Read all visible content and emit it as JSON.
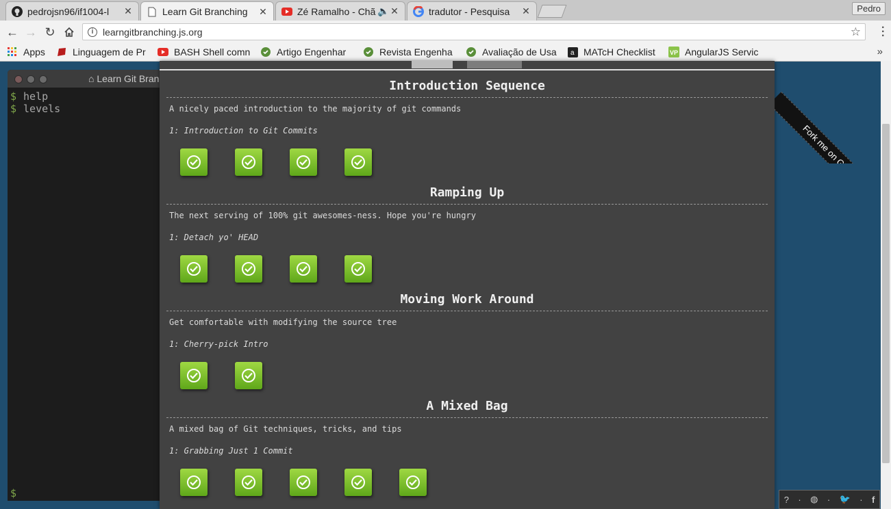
{
  "browser": {
    "tabs": [
      {
        "label": "pedrojsn96/if1004-l",
        "icon": "github-icon",
        "active": false
      },
      {
        "label": "Learn Git Branching",
        "icon": "page-icon",
        "active": true
      },
      {
        "label": "Zé Ramalho - Chã",
        "icon": "youtube-icon",
        "active": false
      },
      {
        "label": "tradutor - Pesquisa",
        "icon": "google-icon",
        "active": false
      }
    ],
    "profile_name": "Pedro",
    "url": "learngitbranching.js.org",
    "bookmarks": [
      {
        "label": "Apps",
        "icon": "apps-grid-icon"
      },
      {
        "label": "Linguagem de Pr",
        "icon": "ruby-icon"
      },
      {
        "label": "BASH Shell comn",
        "icon": "youtube-icon"
      },
      {
        "label": "Artigo Engenhar",
        "icon": "recycle-icon"
      },
      {
        "label": "Revista Engenha",
        "icon": "recycle-icon"
      },
      {
        "label": "Avaliação de Usa",
        "icon": "recycle-icon"
      },
      {
        "label": "MATcH Checklist",
        "icon": "amazon-icon"
      },
      {
        "label": "AngularJS Servic",
        "icon": "vp-icon"
      }
    ]
  },
  "terminal": {
    "title": "Learn Git Bran",
    "prompt": "$",
    "lines": [
      "help",
      "levels"
    ]
  },
  "dialog": {
    "sections": [
      {
        "title": "Introduction Sequence",
        "description": "A nicely paced introduction to the majority of git commands",
        "selected_level": "1: Introduction to Git Commits",
        "level_count": 4
      },
      {
        "title": "Ramping Up",
        "description": "The next serving of 100% git awesomes-ness. Hope you're hungry",
        "selected_level": "1: Detach yo' HEAD",
        "level_count": 4
      },
      {
        "title": "Moving Work Around",
        "description": "Get comfortable with modifying the source tree",
        "selected_level": "1: Cherry-pick Intro",
        "level_count": 2
      },
      {
        "title": "A Mixed Bag",
        "description": "A mixed bag of Git techniques, tricks, and tips",
        "selected_level": "1: Grabbing Just 1 Commit",
        "level_count": 5
      }
    ]
  },
  "fork_ribbon": "Fork me on GitHub",
  "colors": {
    "level_complete": "#7cc52d",
    "dialog_bg": "#424242",
    "page_bg": "#1f4d6e"
  }
}
